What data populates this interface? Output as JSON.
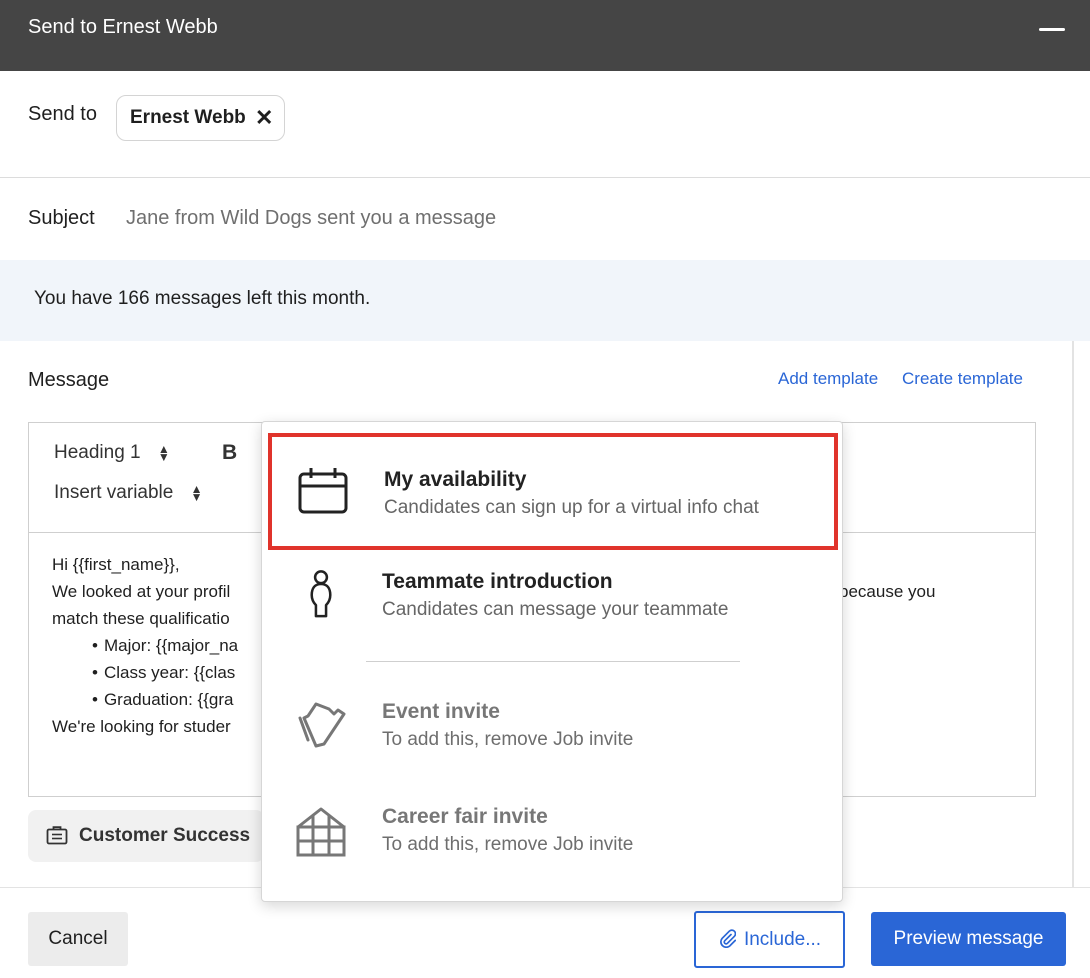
{
  "window": {
    "title": "Send to Ernest Webb"
  },
  "send_to": {
    "label": "Send to",
    "recipient": "Ernest Webb",
    "remove_symbol": "✕"
  },
  "subject": {
    "label": "Subject",
    "placeholder": "Jane from Wild Dogs sent you a message"
  },
  "banner": {
    "text": "You have 166 messages left this month."
  },
  "message": {
    "label": "Message",
    "add_template": "Add template",
    "create_template": "Create template",
    "toolbar": {
      "heading_select": "Heading 1",
      "bold": "B",
      "insert_variable": "Insert variable"
    },
    "body": {
      "greeting": "Hi {{first_name}},",
      "line1": "We looked at your profil",
      "line1_tail": "because you",
      "line2": "match these qualificatio",
      "bullets": [
        "Major: {{major_na",
        "Class year: {{clas",
        "Graduation: {{gra"
      ],
      "line3": "We're looking for studer"
    }
  },
  "job_chip": {
    "label": "Customer Success",
    "icon": "briefcase-icon"
  },
  "include_menu": {
    "items": [
      {
        "title": "My availability",
        "description": "Candidates can sign up for a virtual info chat",
        "icon": "calendar-icon",
        "state": "selected"
      },
      {
        "title": "Teammate introduction",
        "description": "Candidates can message your teammate",
        "icon": "person-icon",
        "state": "enabled"
      },
      {
        "title": "Event invite",
        "description": "To add this, remove Job invite",
        "icon": "ticket-icon",
        "state": "disabled"
      },
      {
        "title": "Career fair invite",
        "description": "To add this, remove Job invite",
        "icon": "booth-icon",
        "state": "disabled"
      }
    ]
  },
  "footer": {
    "cancel": "Cancel",
    "include": "Include...",
    "preview": "Preview message"
  },
  "colors": {
    "titlebar": "#454545",
    "accent": "#2a66d6",
    "highlight_border": "#e0332b",
    "banner": "#f1f5fa"
  }
}
